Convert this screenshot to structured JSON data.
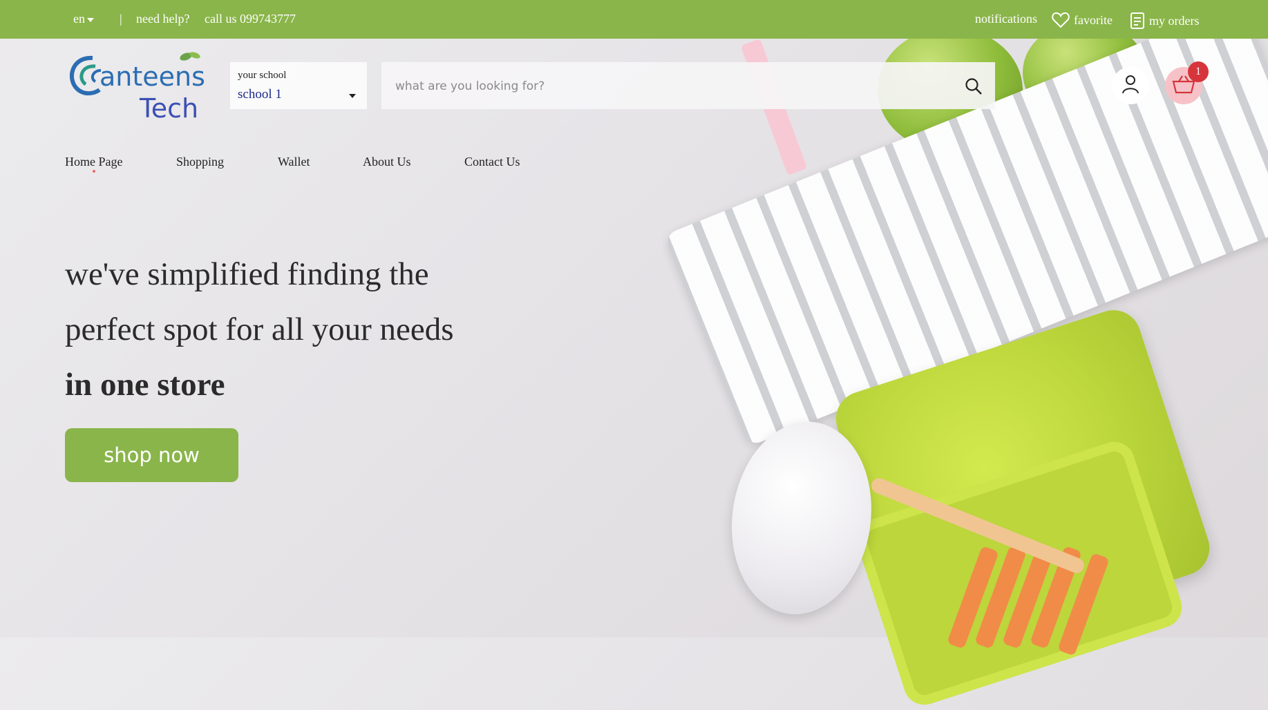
{
  "topbar": {
    "language": "en",
    "separator": "|",
    "help": "need help?",
    "phone": "call us 099743777",
    "notifications": "notifications",
    "favorite": "favorite",
    "my_orders": "my orders"
  },
  "brand": {
    "logo_line1": "Canteens",
    "logo_line2": "Tech"
  },
  "school_select": {
    "label": "your school",
    "value": "school 1"
  },
  "search": {
    "placeholder": "what are you looking for?"
  },
  "cart": {
    "count": "1"
  },
  "nav": {
    "items": [
      {
        "label": "Home Page"
      },
      {
        "label": "Shopping"
      },
      {
        "label": "Wallet"
      },
      {
        "label": "About Us"
      },
      {
        "label": "Contact Us"
      }
    ]
  },
  "hero": {
    "line1": "we've simplified finding the",
    "line2": "perfect spot for all your needs",
    "line3": "in one store",
    "cta": "shop now"
  },
  "colors": {
    "brand_green": "#8ab54a",
    "badge_red": "#d5353b"
  }
}
